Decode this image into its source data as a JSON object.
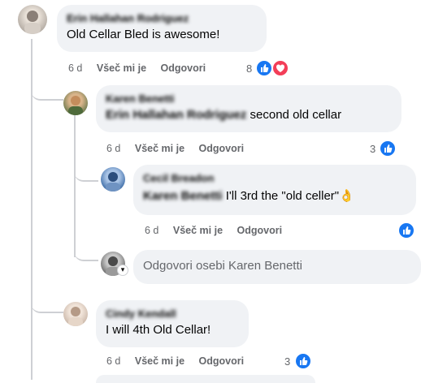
{
  "comments": [
    {
      "author": "Erin Hallahan Rodriguez",
      "text": "Old Cellar Bled is awesome!",
      "time": "6 d",
      "like_label": "Všeč mi je",
      "reply_label": "Odgovori",
      "reactions_count": "8",
      "reactions": [
        "like-icon",
        "love-icon"
      ]
    },
    {
      "author": "Karen Benetti",
      "mention": "Erin Hallahan Rodriguez",
      "text": " second old cellar",
      "time": "6 d",
      "like_label": "Všeč mi je",
      "reply_label": "Odgovori",
      "reactions_count": "3",
      "reactions": [
        "like-icon"
      ]
    },
    {
      "author": "Cecil Breadon",
      "mention": "Karen Benetti",
      "text": " I'll 3rd the \"old celler\"",
      "emoji": "👌",
      "time": "6 d",
      "like_label": "Všeč mi je",
      "reply_label": "Odgovori",
      "reactions_count": "",
      "reactions": [
        "like-icon"
      ]
    },
    {
      "author": "Cindy Kendall",
      "text": "I will 4th Old Cellar!",
      "time": "6 d",
      "like_label": "Všeč mi je",
      "reply_label": "Odgovori",
      "reactions_count": "3",
      "reactions": [
        "like-icon"
      ]
    }
  ],
  "reply_box": {
    "placeholder": "Odgovori osebi Karen Benetti"
  },
  "colors": {
    "bubble": "#f0f2f5",
    "meta_text": "#65676b",
    "like_blue": "#1877f2",
    "love_red": "#f33e58",
    "thread_line": "#ced0d4"
  }
}
